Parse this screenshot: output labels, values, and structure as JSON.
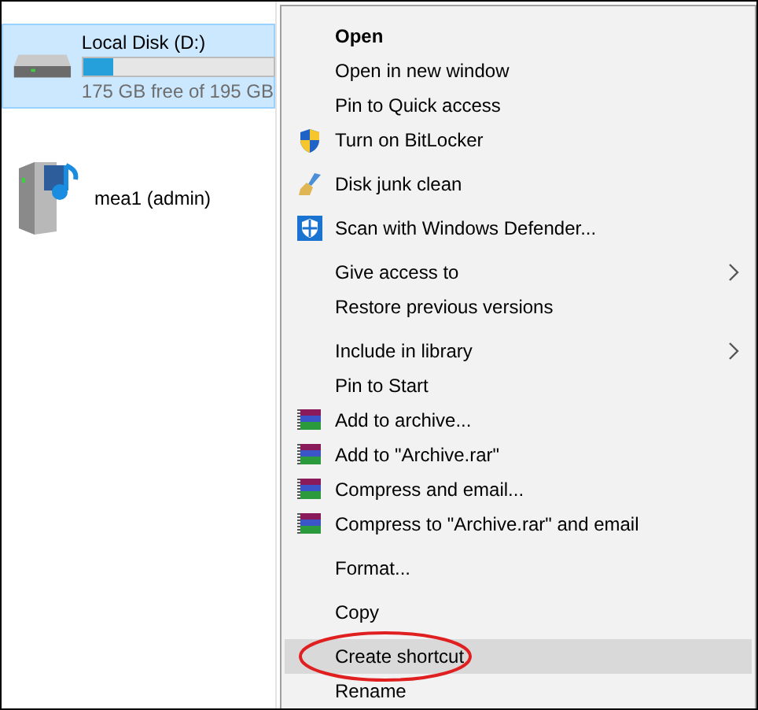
{
  "drives": [
    {
      "name": "Local Disk (D:)",
      "kind": "local",
      "selected": true,
      "level": 0.16,
      "free": "175 GB free of 195 GB"
    },
    {
      "name": "mea1 (admin)",
      "kind": "network",
      "selected": false
    }
  ],
  "context_menu": {
    "groups": [
      {
        "items": [
          {
            "label": "Open",
            "kind": "plain",
            "default": true,
            "selected": false,
            "circled": false
          },
          {
            "label": "Open in new window",
            "kind": "plain",
            "default": false,
            "selected": false,
            "circled": false
          },
          {
            "label": "Pin to Quick access",
            "kind": "plain",
            "default": false,
            "selected": false,
            "circled": false
          },
          {
            "label": "Turn on BitLocker",
            "kind": "bitlocker",
            "default": false,
            "selected": false,
            "circled": false
          }
        ]
      },
      {
        "items": [
          {
            "label": "Disk junk clean",
            "kind": "cleaner",
            "default": false,
            "selected": false,
            "circled": false
          }
        ]
      },
      {
        "items": [
          {
            "label": "Scan with Windows Defender...",
            "kind": "defender",
            "default": false,
            "selected": false,
            "circled": false
          }
        ]
      },
      {
        "items": [
          {
            "label": "Give access to",
            "kind": "submenu",
            "default": false,
            "selected": false,
            "circled": false
          },
          {
            "label": "Restore previous versions",
            "kind": "plain",
            "default": false,
            "selected": false,
            "circled": false
          }
        ]
      },
      {
        "items": [
          {
            "label": "Include in library",
            "kind": "submenu",
            "default": false,
            "selected": false,
            "circled": false
          },
          {
            "label": "Pin to Start",
            "kind": "plain",
            "default": false,
            "selected": false,
            "circled": false
          },
          {
            "label": "Add to archive...",
            "kind": "archive",
            "default": false,
            "selected": false,
            "circled": false
          },
          {
            "label": "Add to \"Archive.rar\"",
            "kind": "archive",
            "default": false,
            "selected": false,
            "circled": false
          },
          {
            "label": "Compress and email...",
            "kind": "archive",
            "default": false,
            "selected": false,
            "circled": false
          },
          {
            "label": "Compress to \"Archive.rar\" and email",
            "kind": "archive",
            "default": false,
            "selected": false,
            "circled": false
          }
        ]
      },
      {
        "items": [
          {
            "label": "Format...",
            "kind": "plain",
            "default": false,
            "selected": false,
            "circled": false
          }
        ]
      },
      {
        "items": [
          {
            "label": "Copy",
            "kind": "plain",
            "default": false,
            "selected": false,
            "circled": false
          }
        ]
      },
      {
        "items": [
          {
            "label": "Create shortcut",
            "kind": "plain",
            "default": false,
            "selected": true,
            "circled": true
          },
          {
            "label": "Rename",
            "kind": "plain",
            "default": false,
            "selected": false,
            "circled": false
          }
        ]
      }
    ]
  }
}
